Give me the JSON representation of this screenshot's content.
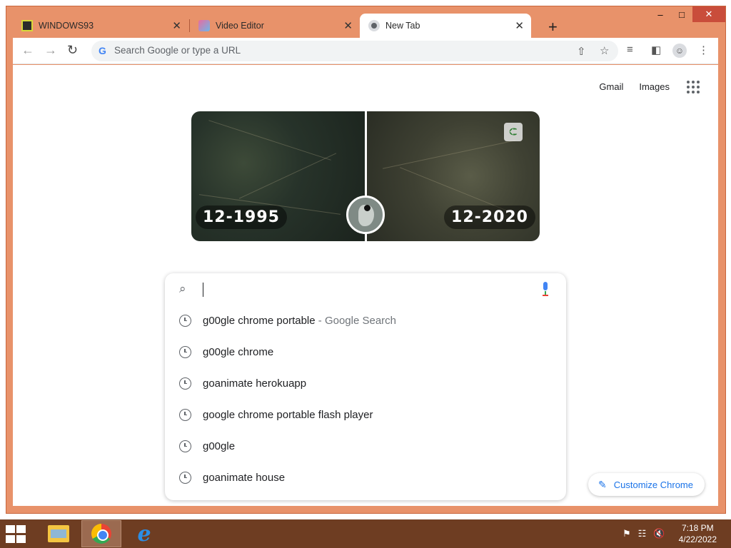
{
  "browser": {
    "tabs": [
      {
        "title": "WINDOWS93",
        "active": false
      },
      {
        "title": "Video Editor",
        "active": false
      },
      {
        "title": "New Tab",
        "active": true
      }
    ],
    "omnibox": {
      "placeholder": "Search Google or type a URL"
    }
  },
  "page": {
    "top_links": [
      "Gmail",
      "Images"
    ],
    "doodle": {
      "year_left": "12-1995",
      "year_right": "12-2020"
    },
    "search": {
      "value": "",
      "suggestions": [
        {
          "text": "g00gle chrome portable",
          "suffix": " - Google Search"
        },
        {
          "text": "g00gle chrome",
          "suffix": ""
        },
        {
          "text": "goanimate herokuapp",
          "suffix": ""
        },
        {
          "text": "google chrome portable flash player",
          "suffix": ""
        },
        {
          "text": "g00gle",
          "suffix": ""
        },
        {
          "text": "goanimate house",
          "suffix": ""
        }
      ]
    },
    "customize_label": "Customize Chrome"
  },
  "taskbar": {
    "time": "7:18 PM",
    "date": "4/22/2022"
  },
  "colors": {
    "accent": "#1a73e8",
    "window_frame": "#e8926a",
    "taskbar": "#6e3d22"
  }
}
